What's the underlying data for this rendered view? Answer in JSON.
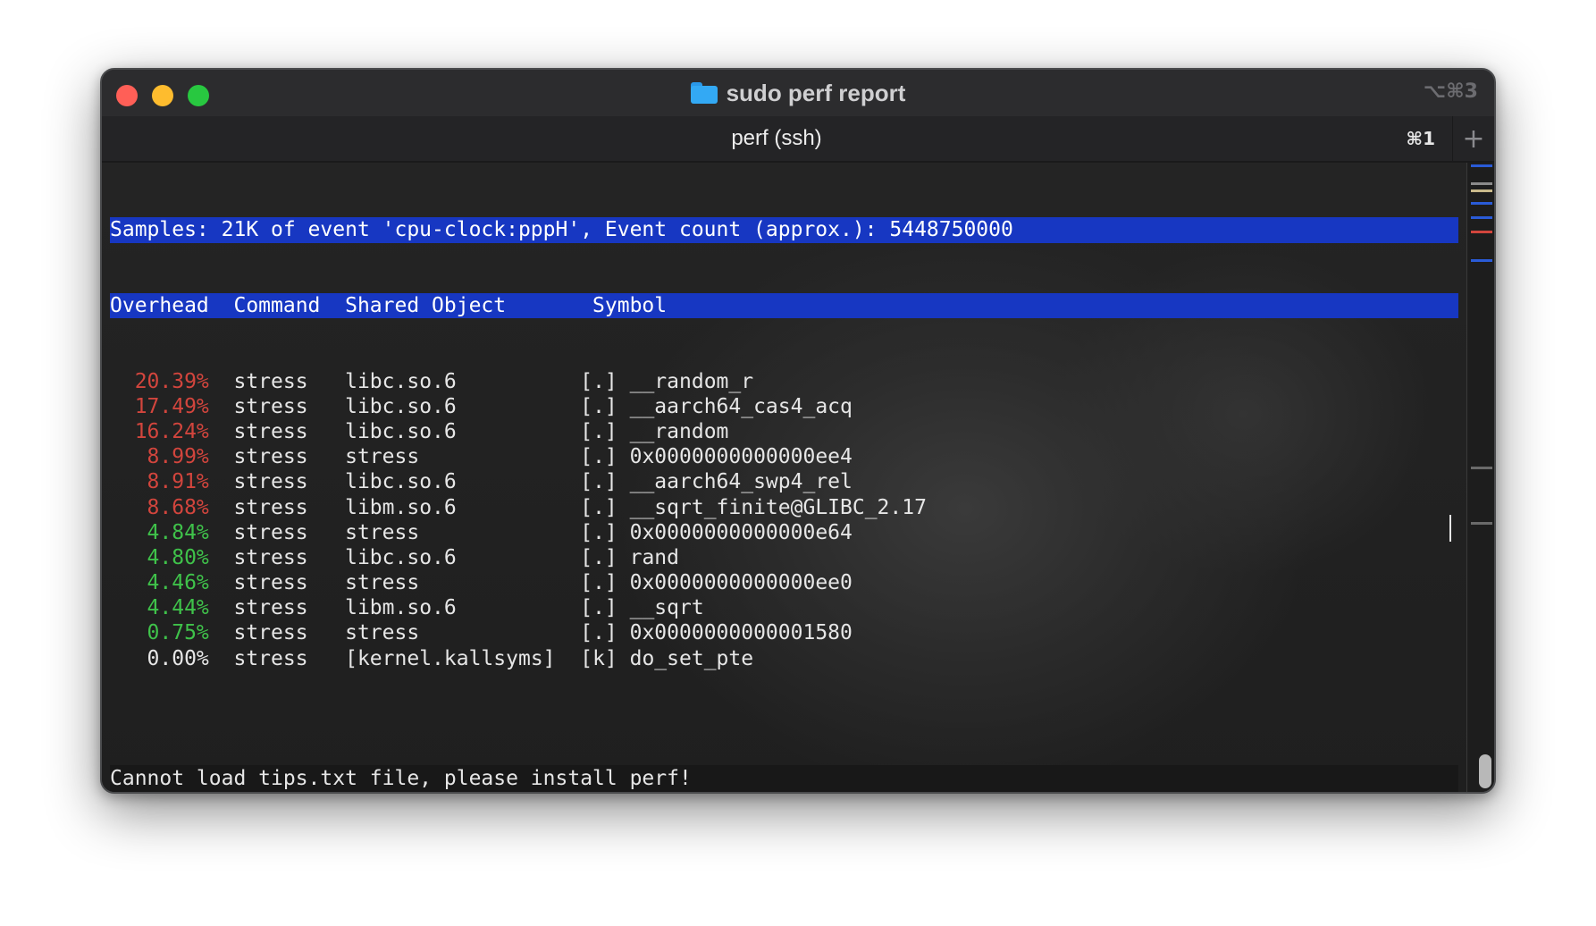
{
  "window": {
    "title": "sudo perf report",
    "shortcut": "⌥⌘3"
  },
  "tab": {
    "label": "perf (ssh)",
    "shortcut": "⌘1",
    "new_tab_label": "+"
  },
  "terminal": {
    "header_line": "Samples: 21K of event 'cpu-clock:pppH', Event count (approx.): 5448750000",
    "columns_line": "Overhead  Command  Shared Object       Symbol",
    "rows": [
      {
        "overhead": "20.39%",
        "level": "red",
        "command": "stress",
        "object": "libc.so.6",
        "type": "[.]",
        "symbol": "__random_r"
      },
      {
        "overhead": "17.49%",
        "level": "red",
        "command": "stress",
        "object": "libc.so.6",
        "type": "[.]",
        "symbol": "__aarch64_cas4_acq"
      },
      {
        "overhead": "16.24%",
        "level": "red",
        "command": "stress",
        "object": "libc.so.6",
        "type": "[.]",
        "symbol": "__random"
      },
      {
        "overhead": "8.99%",
        "level": "red",
        "command": "stress",
        "object": "stress",
        "type": "[.]",
        "symbol": "0x0000000000000ee4"
      },
      {
        "overhead": "8.91%",
        "level": "red",
        "command": "stress",
        "object": "libc.so.6",
        "type": "[.]",
        "symbol": "__aarch64_swp4_rel"
      },
      {
        "overhead": "8.68%",
        "level": "red",
        "command": "stress",
        "object": "libm.so.6",
        "type": "[.]",
        "symbol": "__sqrt_finite@GLIBC_2.17"
      },
      {
        "overhead": "4.84%",
        "level": "green",
        "command": "stress",
        "object": "stress",
        "type": "[.]",
        "symbol": "0x0000000000000e64"
      },
      {
        "overhead": "4.80%",
        "level": "green",
        "command": "stress",
        "object": "libc.so.6",
        "type": "[.]",
        "symbol": "rand"
      },
      {
        "overhead": "4.46%",
        "level": "green",
        "command": "stress",
        "object": "stress",
        "type": "[.]",
        "symbol": "0x0000000000000ee0"
      },
      {
        "overhead": "4.44%",
        "level": "green",
        "command": "stress",
        "object": "libm.so.6",
        "type": "[.]",
        "symbol": "__sqrt"
      },
      {
        "overhead": "0.75%",
        "level": "green",
        "command": "stress",
        "object": "stress",
        "type": "[.]",
        "symbol": "0x0000000000001580"
      },
      {
        "overhead": "0.00%",
        "level": "white",
        "command": "stress",
        "object": "[kernel.kallsyms]",
        "type": "[k]",
        "symbol": "do_set_pte"
      }
    ],
    "status_line": "Cannot load tips.txt file, please install perf!"
  },
  "colors": {
    "header_bg": "#1737c2",
    "high_overhead": "#d2453d",
    "medium_overhead": "#3fc24a"
  }
}
